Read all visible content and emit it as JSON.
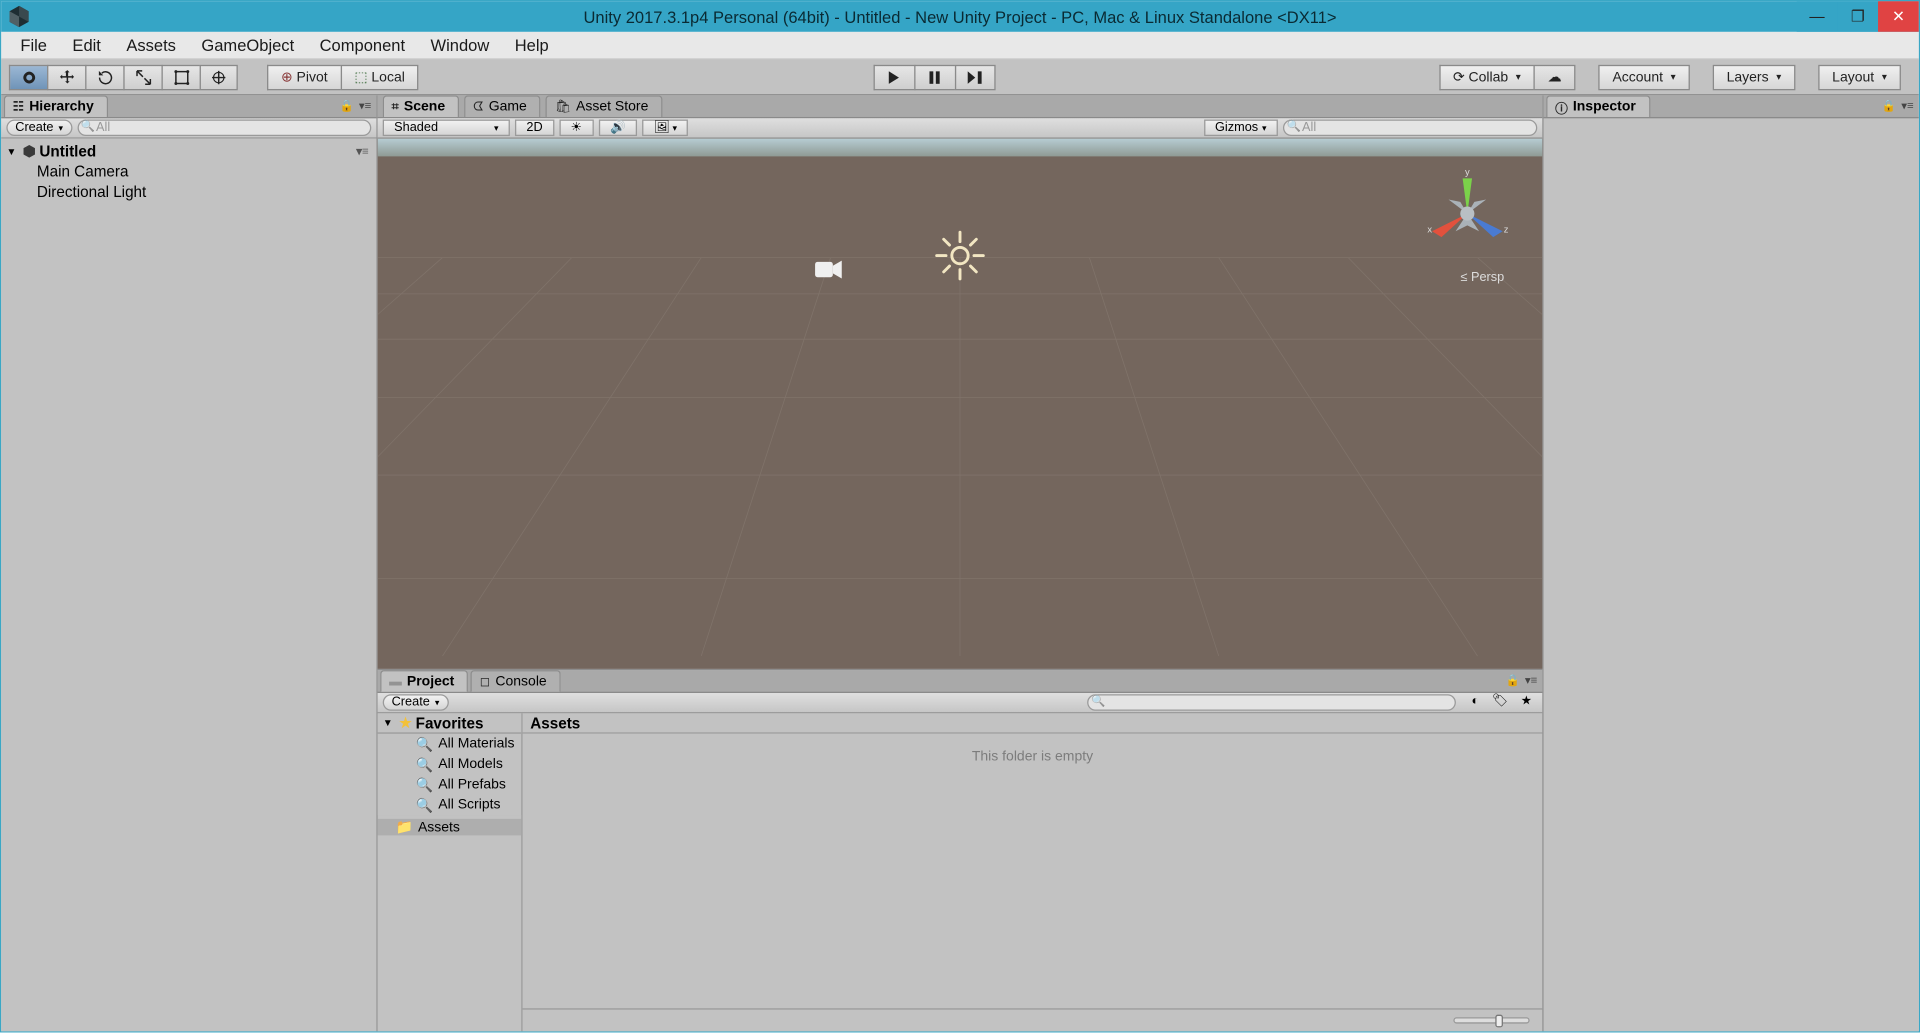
{
  "title": "Unity 2017.3.1p4 Personal (64bit) - Untitled - New Unity Project - PC, Mac & Linux Standalone <DX11>",
  "menu": [
    "File",
    "Edit",
    "Assets",
    "GameObject",
    "Component",
    "Window",
    "Help"
  ],
  "toolbar": {
    "pivot": "Pivot",
    "local": "Local",
    "collab": "Collab",
    "account": "Account",
    "layers": "Layers",
    "layout": "Layout"
  },
  "hierarchy": {
    "tab": "Hierarchy",
    "create": "Create",
    "search_placeholder": "All",
    "scene": "Untitled",
    "items": [
      "Main Camera",
      "Directional Light"
    ]
  },
  "scene": {
    "tabs": {
      "scene": "Scene",
      "game": "Game",
      "asset_store": "Asset Store"
    },
    "shading": "Shaded",
    "mode2d": "2D",
    "gizmos": "Gizmos",
    "search_placeholder": "All",
    "persp": "Persp",
    "axis": {
      "x": "x",
      "y": "y",
      "z": "z"
    }
  },
  "inspector": {
    "tab": "Inspector"
  },
  "project": {
    "tabs": {
      "project": "Project",
      "console": "Console"
    },
    "create": "Create",
    "favorites": "Favorites",
    "fav_items": [
      "All Materials",
      "All Models",
      "All Prefabs",
      "All Scripts"
    ],
    "assets": "Assets",
    "breadcrumb": "Assets",
    "empty": "This folder is empty"
  }
}
